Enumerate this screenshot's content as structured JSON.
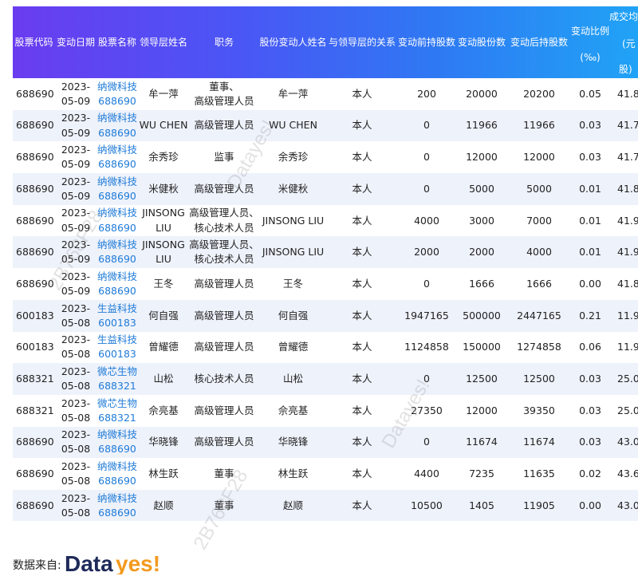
{
  "headers": {
    "code": "股票代码",
    "date": "变动日期",
    "name": "股票名称",
    "leader": "领导层姓名",
    "position": "职务",
    "changer": "股份变动人姓名",
    "relation": "与领导层的关系",
    "before": "变动前持股数",
    "change": "变动股份数",
    "after": "变动后持股数",
    "pct_l1": "变动比例",
    "pct_l2": "(‰)",
    "price_l1": "成交均",
    "price_l2": "(元",
    "price_l3": "股)"
  },
  "rows": [
    {
      "code": "688690",
      "date": [
        "2023-",
        "05-09"
      ],
      "name": [
        "纳微科技",
        "688690"
      ],
      "leader": [
        "牟一萍"
      ],
      "position": [
        "董事、",
        "高级管理人员"
      ],
      "changer": [
        "牟一萍"
      ],
      "relation": "本人",
      "before": "200",
      "change": "20000",
      "after": "20200",
      "pct": "0.05",
      "price": "41.8"
    },
    {
      "code": "688690",
      "date": [
        "2023-",
        "05-09"
      ],
      "name": [
        "纳微科技",
        "688690"
      ],
      "leader": [
        "WU CHEN"
      ],
      "position": [
        "高级管理人员"
      ],
      "changer": [
        "WU CHEN"
      ],
      "relation": "本人",
      "before": "0",
      "change": "11966",
      "after": "11966",
      "pct": "0.03",
      "price": "41.7"
    },
    {
      "code": "688690",
      "date": [
        "2023-",
        "05-09"
      ],
      "name": [
        "纳微科技",
        "688690"
      ],
      "leader": [
        "余秀珍"
      ],
      "position": [
        "监事"
      ],
      "changer": [
        "余秀珍"
      ],
      "relation": "本人",
      "before": "0",
      "change": "12000",
      "after": "12000",
      "pct": "0.03",
      "price": "41.7"
    },
    {
      "code": "688690",
      "date": [
        "2023-",
        "05-09"
      ],
      "name": [
        "纳微科技",
        "688690"
      ],
      "leader": [
        "米健秋"
      ],
      "position": [
        "高级管理人员"
      ],
      "changer": [
        "米健秋"
      ],
      "relation": "本人",
      "before": "0",
      "change": "5000",
      "after": "5000",
      "pct": "0.01",
      "price": "41.8"
    },
    {
      "code": "688690",
      "date": [
        "2023-",
        "05-09"
      ],
      "name": [
        "纳微科技",
        "688690"
      ],
      "leader": [
        "JINSONG",
        "LIU"
      ],
      "position": [
        "高级管理人员、",
        "核心技术人员"
      ],
      "changer": [
        "JINSONG LIU"
      ],
      "relation": "本人",
      "before": "4000",
      "change": "3000",
      "after": "7000",
      "pct": "0.01",
      "price": "41.9"
    },
    {
      "code": "688690",
      "date": [
        "2023-",
        "05-09"
      ],
      "name": [
        "纳微科技",
        "688690"
      ],
      "leader": [
        "JINSONG",
        "LIU"
      ],
      "position": [
        "高级管理人员、",
        "核心技术人员"
      ],
      "changer": [
        "JINSONG LIU"
      ],
      "relation": "本人",
      "before": "2000",
      "change": "2000",
      "after": "4000",
      "pct": "0.01",
      "price": "41.9"
    },
    {
      "code": "688690",
      "date": [
        "2023-",
        "05-09"
      ],
      "name": [
        "纳微科技",
        "688690"
      ],
      "leader": [
        "王冬"
      ],
      "position": [
        "高级管理人员"
      ],
      "changer": [
        "王冬"
      ],
      "relation": "本人",
      "before": "0",
      "change": "1666",
      "after": "1666",
      "pct": "0.00",
      "price": "41.8"
    },
    {
      "code": "600183",
      "date": [
        "2023-",
        "05-08"
      ],
      "name": [
        "生益科技",
        "600183"
      ],
      "leader": [
        "何自强"
      ],
      "position": [
        "高级管理人员"
      ],
      "changer": [
        "何自强"
      ],
      "relation": "本人",
      "before": "1947165",
      "change": "500000",
      "after": "2447165",
      "pct": "0.21",
      "price": "11.9"
    },
    {
      "code": "600183",
      "date": [
        "2023-",
        "05-08"
      ],
      "name": [
        "生益科技",
        "600183"
      ],
      "leader": [
        "曾耀德"
      ],
      "position": [
        "高级管理人员"
      ],
      "changer": [
        "曾耀德"
      ],
      "relation": "本人",
      "before": "1124858",
      "change": "150000",
      "after": "1274858",
      "pct": "0.06",
      "price": "11.9"
    },
    {
      "code": "688321",
      "date": [
        "2023-",
        "05-08"
      ],
      "name": [
        "微芯生物",
        "688321"
      ],
      "leader": [
        "山松"
      ],
      "position": [
        "核心技术人员"
      ],
      "changer": [
        "山松"
      ],
      "relation": "本人",
      "before": "0",
      "change": "12500",
      "after": "12500",
      "pct": "0.03",
      "price": "25.0"
    },
    {
      "code": "688321",
      "date": [
        "2023-",
        "05-08"
      ],
      "name": [
        "微芯生物",
        "688321"
      ],
      "leader": [
        "佘亮基"
      ],
      "position": [
        "高级管理人员"
      ],
      "changer": [
        "佘亮基"
      ],
      "relation": "本人",
      "before": "27350",
      "change": "12000",
      "after": "39350",
      "pct": "0.03",
      "price": "25.0"
    },
    {
      "code": "688690",
      "date": [
        "2023-",
        "05-08"
      ],
      "name": [
        "纳微科技",
        "688690"
      ],
      "leader": [
        "华晓锋"
      ],
      "position": [
        "高级管理人员"
      ],
      "changer": [
        "华晓锋"
      ],
      "relation": "本人",
      "before": "0",
      "change": "11674",
      "after": "11674",
      "pct": "0.03",
      "price": "43.0"
    },
    {
      "code": "688690",
      "date": [
        "2023-",
        "05-08"
      ],
      "name": [
        "纳微科技",
        "688690"
      ],
      "leader": [
        "林生跃"
      ],
      "position": [
        "董事"
      ],
      "changer": [
        "林生跃"
      ],
      "relation": "本人",
      "before": "4400",
      "change": "7235",
      "after": "11635",
      "pct": "0.02",
      "price": "43.6"
    },
    {
      "code": "688690",
      "date": [
        "2023-",
        "05-08"
      ],
      "name": [
        "纳微科技",
        "688690"
      ],
      "leader": [
        "赵顺"
      ],
      "position": [
        "董事"
      ],
      "changer": [
        "赵顺"
      ],
      "relation": "本人",
      "before": "10500",
      "change": "1405",
      "after": "11905",
      "pct": "0.00",
      "price": "43.0"
    }
  ],
  "watermarks": [
    "Datayes!",
    "2B768F28",
    "Datayes!",
    "2B768F28"
  ],
  "footer": {
    "label": "数据来自:",
    "logo_a": "Data",
    "logo_b": "yes!"
  },
  "colors": {
    "header_start": "#6a3cf0",
    "header_end": "#1fa7f6",
    "link": "#1f7bd8",
    "row_alt": "#eef2fb",
    "logo_navy": "#1e2a5a",
    "logo_orange": "#f39a1e"
  }
}
